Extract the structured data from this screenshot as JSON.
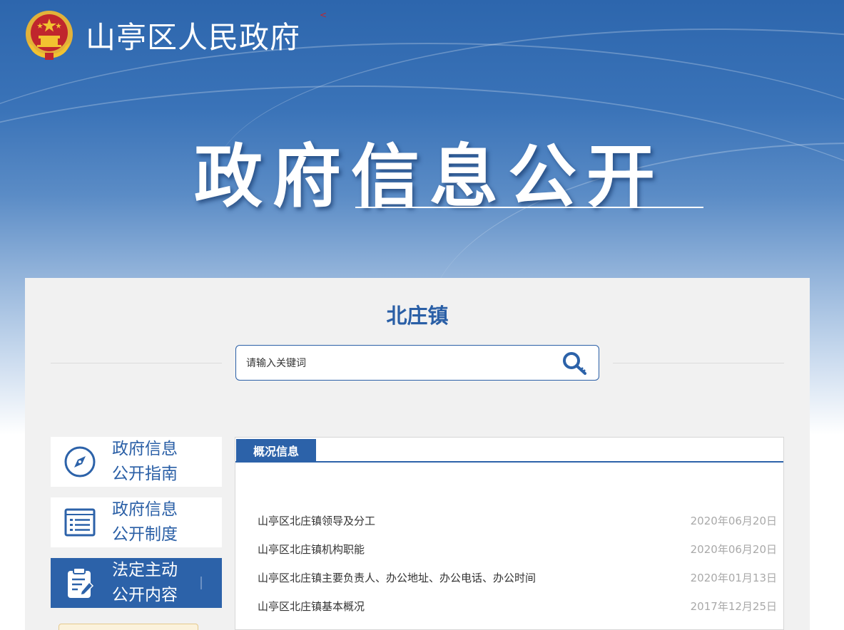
{
  "header": {
    "site_title": "山亭区人民政府",
    "back_mark": "<"
  },
  "hero": {
    "title": "政府信息公开"
  },
  "panel": {
    "town_name": "北庄镇",
    "search": {
      "placeholder": "请输入关键词"
    }
  },
  "sidebar": {
    "items": [
      {
        "line1": "政府信息",
        "line2": "公开指南",
        "icon": "compass-icon"
      },
      {
        "line1": "政府信息",
        "line2": "公开制度",
        "icon": "list-icon"
      },
      {
        "line1": "法定主动",
        "line2": "公开内容",
        "icon": "clipboard-edit-icon"
      }
    ]
  },
  "content": {
    "tab_label": "概况信息",
    "rows": [
      {
        "title": "山亭区北庄镇领导及分工",
        "date": "2020年06月20日"
      },
      {
        "title": "山亭区北庄镇机构职能",
        "date": "2020年06月20日"
      },
      {
        "title": "山亭区北庄镇主要负责人、办公地址、办公电话、办公时间",
        "date": "2020年01月13日"
      },
      {
        "title": "山亭区北庄镇基本概况",
        "date": "2017年12月25日"
      }
    ]
  },
  "colors": {
    "brand_blue": "#2c62a9",
    "emblem_red": "#c0262d",
    "emblem_gold": "#f2c230"
  }
}
